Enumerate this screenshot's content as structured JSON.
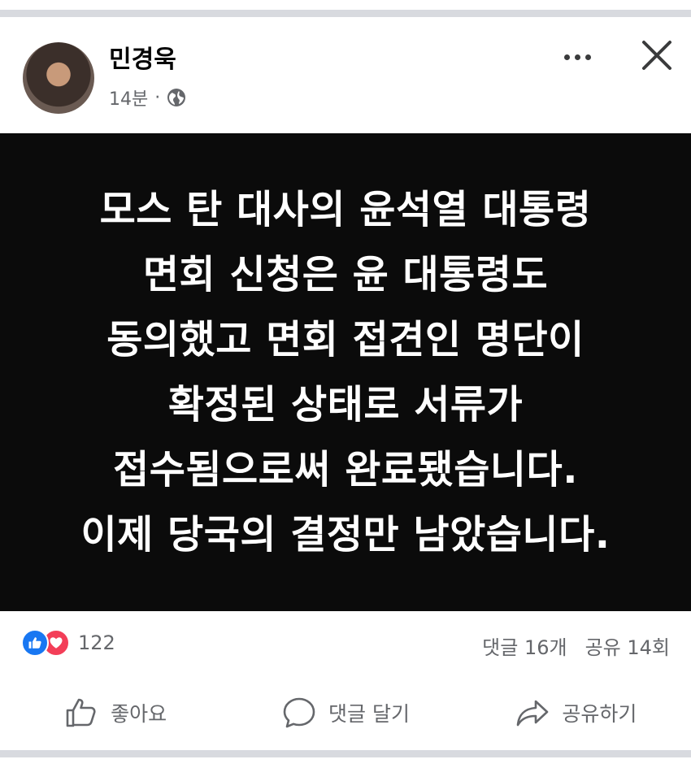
{
  "post": {
    "author": "민경욱",
    "time": "14분",
    "dot": "·",
    "visibility_icon": "globe-icon",
    "more_icon": "more-options-icon",
    "close_icon": "close-icon"
  },
  "image_text": {
    "lines": [
      "모스 탄 대사의 윤석열 대통령",
      "면회 신청은 윤 대통령도",
      "동의했고 면회 접견인 명단이",
      "확정된 상태로 서류가",
      "접수됨으로써 완료됐습니다.",
      "이제 당국의 결정만 남았습니다."
    ]
  },
  "stats": {
    "reaction_icons": [
      "like-reaction-icon",
      "love-reaction-icon"
    ],
    "reaction_count": "122",
    "comments": "댓글 16개",
    "shares": "공유 14회"
  },
  "actions": {
    "like": "좋아요",
    "comment": "댓글 달기",
    "share": "공유하기"
  },
  "colors": {
    "like_blue": "#1877f2",
    "love_red": "#f33e58",
    "muted_text": "#65676b",
    "image_bg": "#0b0b0b"
  }
}
